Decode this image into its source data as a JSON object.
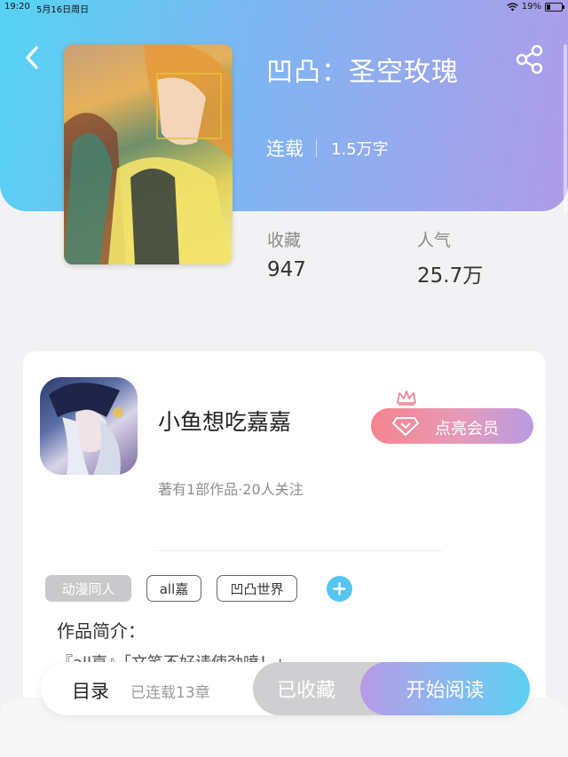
{
  "status_bar": {
    "time": "19:20",
    "date": "5月16日周日",
    "battery": "19%",
    "battery_level_percent": 19,
    "wifi_icon": "wifi-icon"
  },
  "header": {
    "title": "凹凸：圣空玫瑰",
    "status": "连载",
    "word_count": "1.5万字",
    "back_icon": "chevron-left-icon",
    "share_icon": "share-icon"
  },
  "stats": {
    "favorites_label": "收藏",
    "favorites_value": "947",
    "popularity_label": "人气",
    "popularity_value": "25.7万"
  },
  "author": {
    "name": "小鱼想吃嘉嘉",
    "info": "著有1部作品·20人关注",
    "vip_button": "点亮会员"
  },
  "tags": [
    {
      "label": "动漫同人"
    },
    {
      "label": "all嘉"
    },
    {
      "label": "凹凸世界"
    }
  ],
  "intro": {
    "title": "作品简介：",
    "text": "『all嘉』「文笔不好请使劲喷！」"
  },
  "bottom_bar": {
    "toc_label": "目录",
    "toc_sub": "已连载13章",
    "collected_label": "已收藏",
    "read_label": "开始阅读"
  },
  "colors": {
    "header_gradient_start": "#56d3f3",
    "header_gradient_end": "#b09be8",
    "vip_pink": "#f6848f",
    "add_tag_blue": "#55c5f0",
    "collected_gray": "#cfcfd2"
  }
}
